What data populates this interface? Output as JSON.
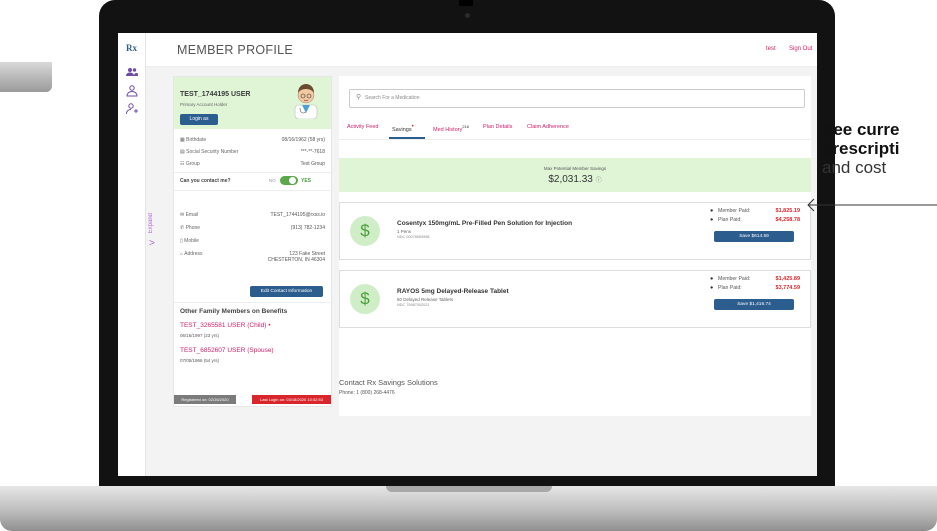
{
  "header": {
    "title": "MEMBER PROFILE",
    "user_link": "test",
    "signout_link": "Sign Out"
  },
  "rail": {
    "logo": "Rx",
    "icons": [
      "people-icon",
      "member-icon",
      "user-add-icon"
    ]
  },
  "expand_tab": {
    "label": "Expand",
    "arrow": ">"
  },
  "profile": {
    "name": "TEST_1744195 USER",
    "subtitle": "Primary Account Holder",
    "login_button": "Login as",
    "birthdate_label": "Birthdate",
    "birthdate_value": "08/16/1962 (58 yrs)",
    "ssn_label": "Social Security Number",
    "ssn_value": "***-**-7618",
    "group_label": "Group",
    "group_value": "Test Group",
    "contact_question": "Can you contact me?",
    "contact_no": "NO",
    "contact_yes": "YES",
    "email_label": "Email",
    "email_value": "TEST_1744195@rxss.io",
    "phone_label": "Phone",
    "phone_value": "(913) 782-1234",
    "mobile_label": "Mobile",
    "address_label": "Address",
    "address_line1": "123 Fake Street",
    "address_line2": "CHESTERTON, IN 46304",
    "edit_button": "Edit Contact Information"
  },
  "family": {
    "title": "Other Family Members on Benefits",
    "members": [
      {
        "name": "TEST_3265581 USER",
        "relation": "(Child)",
        "marker": "•",
        "dob": "06/16/1997 (23 yrs)"
      },
      {
        "name": "TEST_6852607 USER",
        "relation": "(Spouse)",
        "marker": "",
        "dob": "07/05/1966 (54 yrs)"
      }
    ]
  },
  "badges": {
    "registered": "Registered on: 02/26/2020",
    "last_login": "Last Login on: 03/18/2020 10:02:53"
  },
  "search": {
    "placeholder": "Search For a Medication"
  },
  "tabs": [
    "Activity Feed",
    "Savings",
    "Med History",
    "Plan Details",
    "Claim Adherence"
  ],
  "tab_badges": {
    "savings": "•",
    "med_history": "216"
  },
  "savings": {
    "label": "Max Potential Member Savings",
    "value": "$2,031.33",
    "info_icon": "ⓘ"
  },
  "medications": [
    {
      "name": "Cosentyx 150mg/mL Pre-Filled Pen Solution for Injection",
      "qty": "1 Pens",
      "ndc": "NDC 00078063998",
      "member_paid_label": "Member Paid:",
      "member_paid": "$1,825.19",
      "plan_paid_label": "Plan Paid:",
      "plan_paid": "$4,258.78",
      "save_button": "Save $614.59"
    },
    {
      "name": "RAYOS 5mg Delayed-Release Tablet",
      "qty": "60 Delayed Release Tablets",
      "ndc": "NDC 75987002021",
      "member_paid_label": "Member Paid:",
      "member_paid": "$1,425.89",
      "plan_paid_label": "Plan Paid:",
      "plan_paid": "$3,774.59",
      "save_button": "Save $1,416.74"
    }
  ],
  "contact_section": {
    "title": "Contact Rx Savings Solutions",
    "phone": "Phone: 1 (800) 268-4476"
  },
  "caption": {
    "line1": "See curre",
    "line2": "prescripti",
    "line3": "and cost"
  },
  "colors": {
    "accent": "#d2206a",
    "primary_button": "#2b5d8f",
    "highlight_green": "#dff5d6",
    "alert_red": "#d9262c"
  }
}
